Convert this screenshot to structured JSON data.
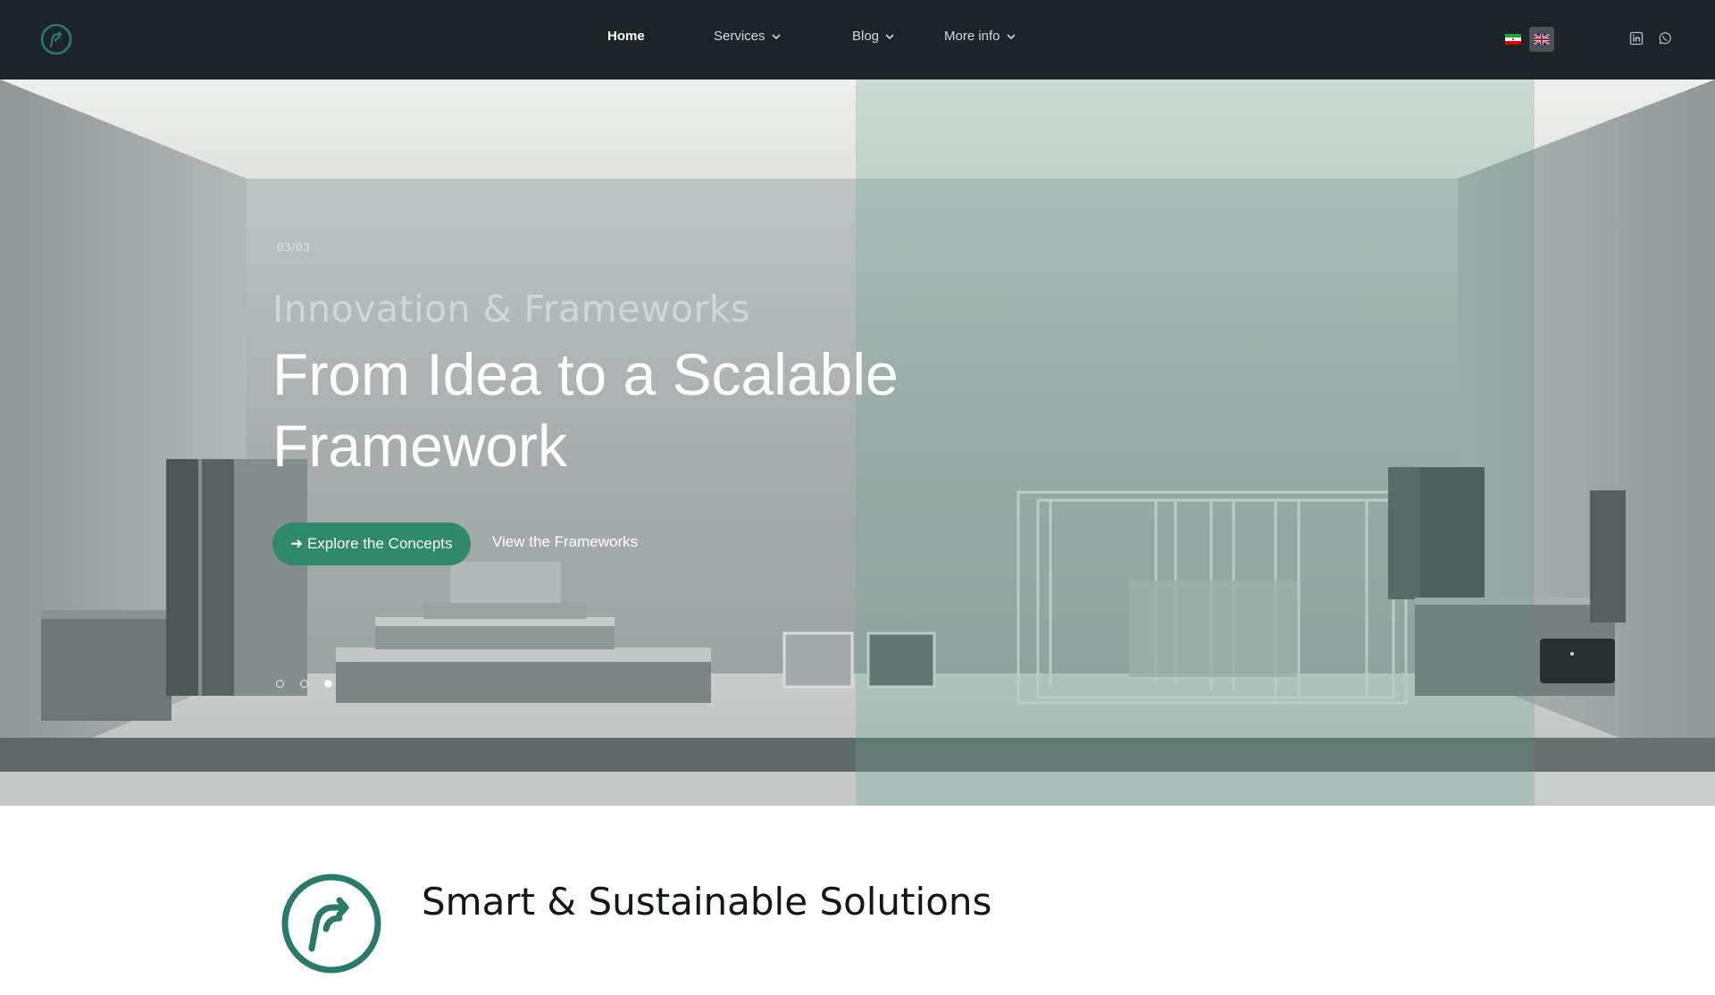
{
  "nav": {
    "items": [
      {
        "label": "Home",
        "active": true,
        "has_dropdown": false
      },
      {
        "label": "Services",
        "active": false,
        "has_dropdown": true
      },
      {
        "label": "Blog",
        "active": false,
        "has_dropdown": true
      },
      {
        "label": "More info",
        "active": false,
        "has_dropdown": true
      }
    ],
    "languages": [
      {
        "icon": "iran-flag-icon",
        "selected": false
      },
      {
        "icon": "uk-flag-icon",
        "selected": true
      }
    ],
    "social": [
      "linkedin-icon",
      "whatsapp-icon"
    ]
  },
  "hero": {
    "slide_counter": "03/03",
    "subtitle": "Innovation & Frameworks",
    "title": "From Idea to a Scalable Framework",
    "primary_button": "➜ Explore the Concepts",
    "secondary_link": "View the Frameworks",
    "slides_total": 3,
    "active_slide": 3
  },
  "about": {
    "title": "Smart & Sustainable Solutions"
  },
  "colors": {
    "navbar": "#1b2527",
    "accent": "#2e8a6b",
    "logo_teal": "#2a7a6c"
  }
}
